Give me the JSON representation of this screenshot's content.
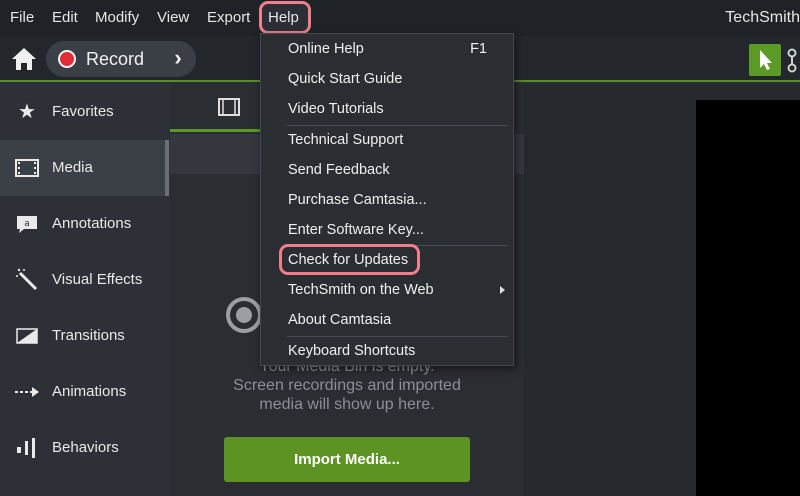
{
  "menubar": {
    "items": [
      "File",
      "Edit",
      "Modify",
      "View",
      "Export",
      "Help"
    ],
    "app_title": "TechSmith"
  },
  "toolbar": {
    "record_label": "Record"
  },
  "sidebar": {
    "items": [
      {
        "label": "Favorites",
        "icon": "star-icon"
      },
      {
        "label": "Media",
        "icon": "film-icon"
      },
      {
        "label": "Annotations",
        "icon": "annotation-icon"
      },
      {
        "label": "Visual Effects",
        "icon": "magic-wand-icon"
      },
      {
        "label": "Transitions",
        "icon": "transition-icon"
      },
      {
        "label": "Animations",
        "icon": "animation-arrow-icon"
      },
      {
        "label": "Behaviors",
        "icon": "behaviors-icon"
      }
    ],
    "active": "Media"
  },
  "media": {
    "empty_line1": "Your Media Bin is empty.",
    "empty_line2": "Screen recordings and imported",
    "empty_line3": "media will show up here.",
    "import_label": "Import Media..."
  },
  "help_menu": {
    "items": [
      {
        "label": "Online Help",
        "shortcut": "F1"
      },
      {
        "label": "Quick Start Guide"
      },
      {
        "label": "Video Tutorials"
      },
      {
        "label": "Technical Support"
      },
      {
        "label": "Send Feedback"
      },
      {
        "label": "Purchase Camtasia..."
      },
      {
        "label": "Enter Software Key..."
      },
      {
        "label": "Check for Updates"
      },
      {
        "label": "TechSmith on the Web"
      },
      {
        "label": "About Camtasia"
      },
      {
        "label": "Keyboard Shortcuts"
      }
    ]
  },
  "colors": {
    "accent_green": "#5c9322",
    "highlight_pink": "#f07f8c",
    "record_red": "#e22d37"
  }
}
